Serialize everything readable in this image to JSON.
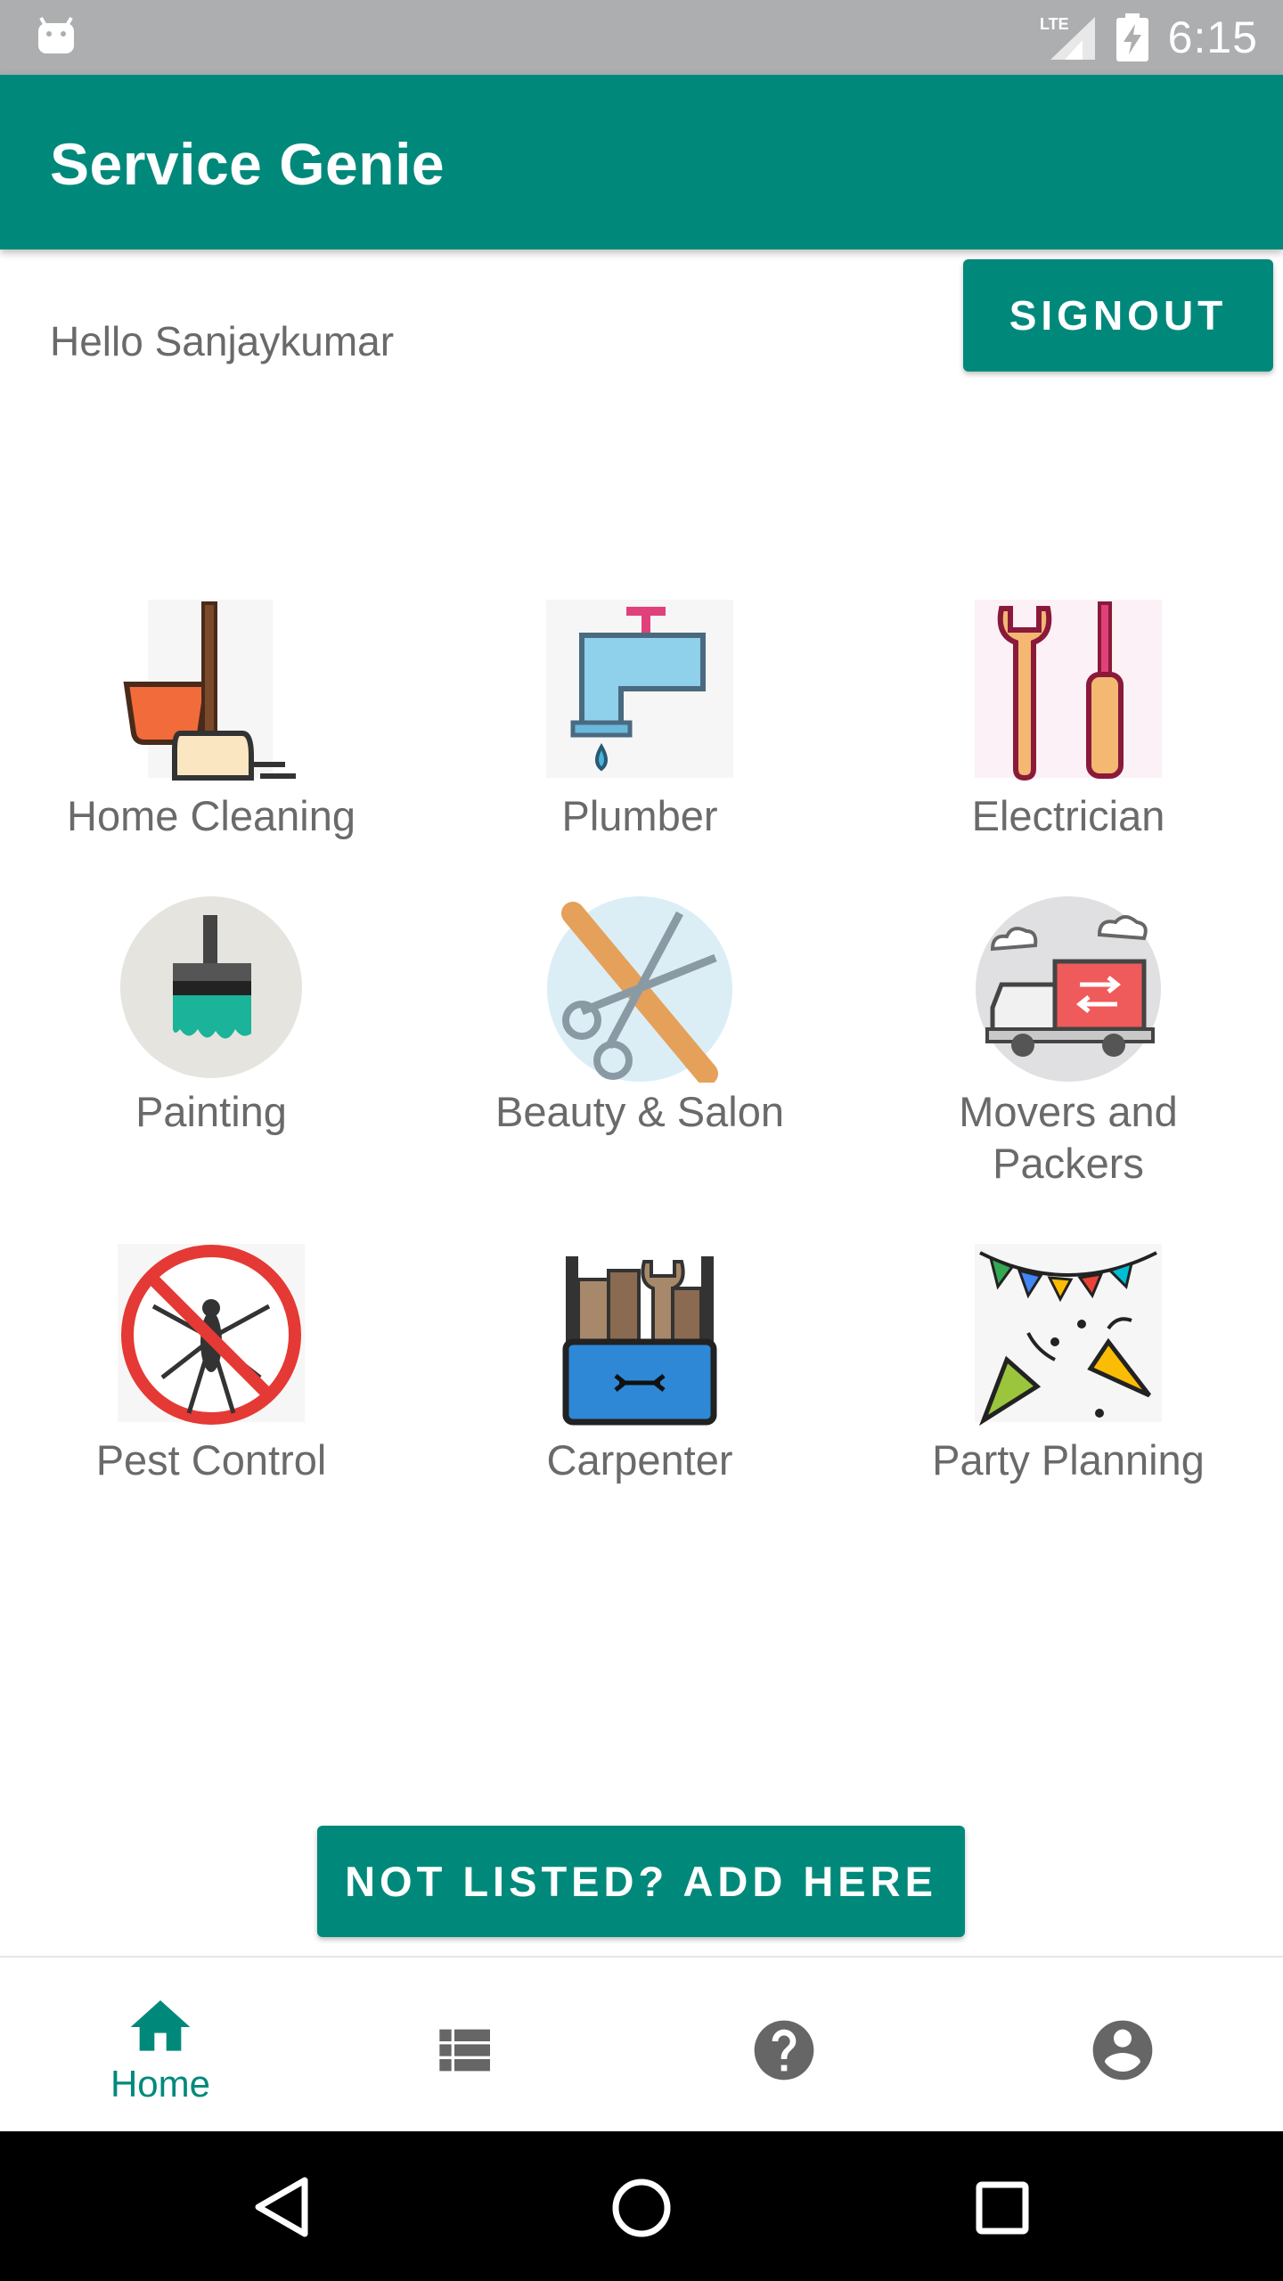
{
  "status_bar": {
    "time": "6:15",
    "network_label": "LTE",
    "icons": [
      "android-icon",
      "signal-icon",
      "battery-charging-icon"
    ]
  },
  "app_bar": {
    "title": "Service Genie"
  },
  "greeting": "Hello Sanjaykumar",
  "signout_label": "SIGNOUT",
  "services": [
    {
      "label": "Home Cleaning",
      "icon": "home-cleaning-icon"
    },
    {
      "label": "Plumber",
      "icon": "plumber-icon"
    },
    {
      "label": "Electrician",
      "icon": "electrician-icon"
    },
    {
      "label": "Painting",
      "icon": "painting-icon"
    },
    {
      "label": "Beauty & Salon",
      "icon": "beauty-salon-icon"
    },
    {
      "label": "Movers and Packers",
      "icon": "movers-packers-icon"
    },
    {
      "label": "Pest Control",
      "icon": "pest-control-icon"
    },
    {
      "label": "Carpenter",
      "icon": "carpenter-icon"
    },
    {
      "label": "Party Planning",
      "icon": "party-planning-icon"
    }
  ],
  "add_button_label": "NOT LISTED? ADD HERE",
  "bottom_nav": [
    {
      "label": "Home",
      "icon": "home-icon",
      "active": true
    },
    {
      "label": "",
      "icon": "list-icon",
      "active": false
    },
    {
      "label": "",
      "icon": "help-icon",
      "active": false
    },
    {
      "label": "",
      "icon": "account-icon",
      "active": false
    }
  ],
  "colors": {
    "primary": "#00897b",
    "status_bar": "#acaeaf",
    "text_gray": "#6a6a6a",
    "inactive_icon": "#666666"
  }
}
